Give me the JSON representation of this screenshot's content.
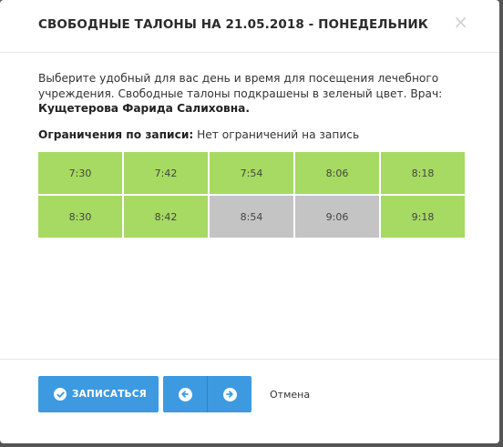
{
  "modal": {
    "title": "СВОБОДНЫЕ ТАЛОНЫ НА 21.05.2018 - ПОНЕДЕЛЬНИК",
    "close_glyph": "×"
  },
  "body": {
    "intro_text": "Выберите удобный для вас день и время для посещения лечебного учреждения. Свободные талоны подкрашены в зеленый цвет. Врач: ",
    "doctor_name": "Кущетерова Фарида Салиховна.",
    "restrictions_label": "Ограничения по записи:",
    "restrictions_value": " Нет ограничений на запись"
  },
  "slots": [
    {
      "time": "7:30",
      "status": "free"
    },
    {
      "time": "7:42",
      "status": "free"
    },
    {
      "time": "7:54",
      "status": "free"
    },
    {
      "time": "8:06",
      "status": "free"
    },
    {
      "time": "8:18",
      "status": "free"
    },
    {
      "time": "8:30",
      "status": "free"
    },
    {
      "time": "8:42",
      "status": "free"
    },
    {
      "time": "8:54",
      "status": "busy"
    },
    {
      "time": "9:06",
      "status": "busy"
    },
    {
      "time": "9:18",
      "status": "free"
    }
  ],
  "footer": {
    "submit_label": "ЗАПИСАТЬСЯ",
    "submit_icon": "check-circle-icon",
    "prev_icon": "arrow-left-circle-icon",
    "next_icon": "arrow-right-circle-icon",
    "cancel_label": "Отмена"
  },
  "colors": {
    "free_slot": "#a6da62",
    "busy_slot": "#c4c4c4",
    "primary_button": "#3d9ae0"
  }
}
